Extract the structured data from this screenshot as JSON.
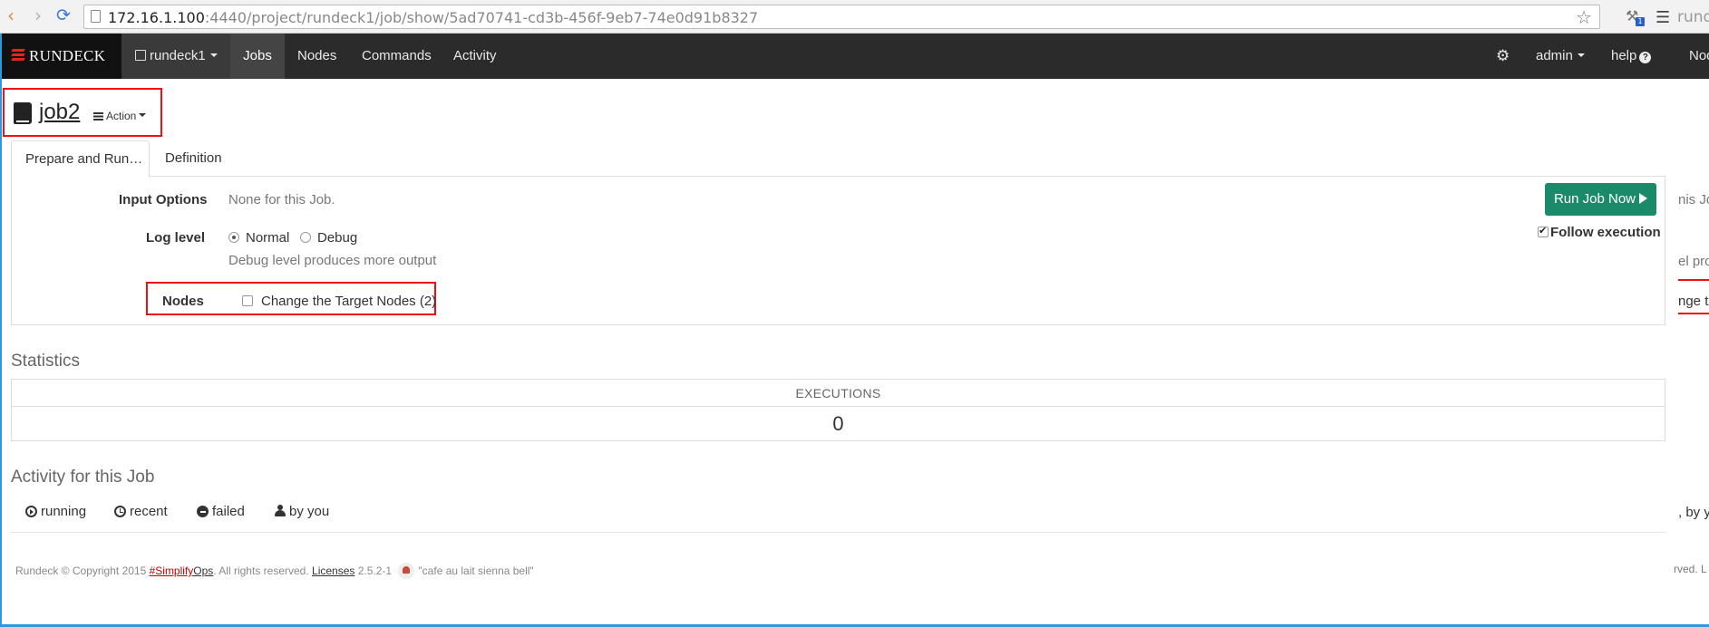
{
  "browser": {
    "url_host": "172.16.1.100",
    "url_rest": ":4440/project/rundeck1/job/show/5ad70741-cd3b-456f-9eb7-74e0d91b8327",
    "back_icon": "‹",
    "forward_icon": "›",
    "reload_icon": "⟳",
    "star_icon": "☆",
    "extension_icon": "⚒",
    "extension_badge": "1",
    "menu_icon": "☰",
    "ghost_tab_text": "runde"
  },
  "navbar": {
    "brand": "RUNDECK",
    "project": "rundeck1",
    "items": [
      "Jobs",
      "Nodes",
      "Commands",
      "Activity"
    ],
    "gear_icon": "⚙",
    "user": "admin",
    "help": "help",
    "help_icon": "?",
    "cut_item": "Nod",
    "colors": {
      "bar": "#2b2b2b",
      "brand_bg": "#111111",
      "logo_red": "#e5251c"
    }
  },
  "job": {
    "title": "job2",
    "action_label": "Action"
  },
  "tabs": [
    {
      "label": "Prepare and Run…",
      "active": true
    },
    {
      "label": "Definition",
      "active": false
    }
  ],
  "run_form": {
    "input_options_label": "Input Options",
    "input_options_value": "None for this Job.",
    "log_level_label": "Log level",
    "log_levels": [
      "Normal",
      "Debug"
    ],
    "log_level_selected": "Normal",
    "log_level_help": "Debug level produces more output",
    "nodes_label": "Nodes",
    "change_nodes_label": "Change the Target Nodes (2)",
    "run_button": "Run Job Now",
    "follow_execution": "Follow execution",
    "accent": "#1b8a6b"
  },
  "ghost": {
    "line1": "nis Jo",
    "line2": "el pro",
    "line3": "nge th",
    "filter": ", by yo",
    "footer": "rved. L"
  },
  "statistics": {
    "title": "Statistics",
    "column": "EXECUTIONS",
    "value": "0"
  },
  "activity": {
    "title": "Activity for this Job",
    "filters": [
      "running",
      "recent",
      "failed",
      "by you"
    ]
  },
  "footer": {
    "prefix": "Rundeck © Copyright 2015 ",
    "simplify": "#Simplify",
    "ops": "Ops",
    "rights": ". All rights reserved. ",
    "licenses": "Licenses",
    "version": " 2.5.2-1 ",
    "codename": "\"cafe au lait sienna bell\""
  }
}
